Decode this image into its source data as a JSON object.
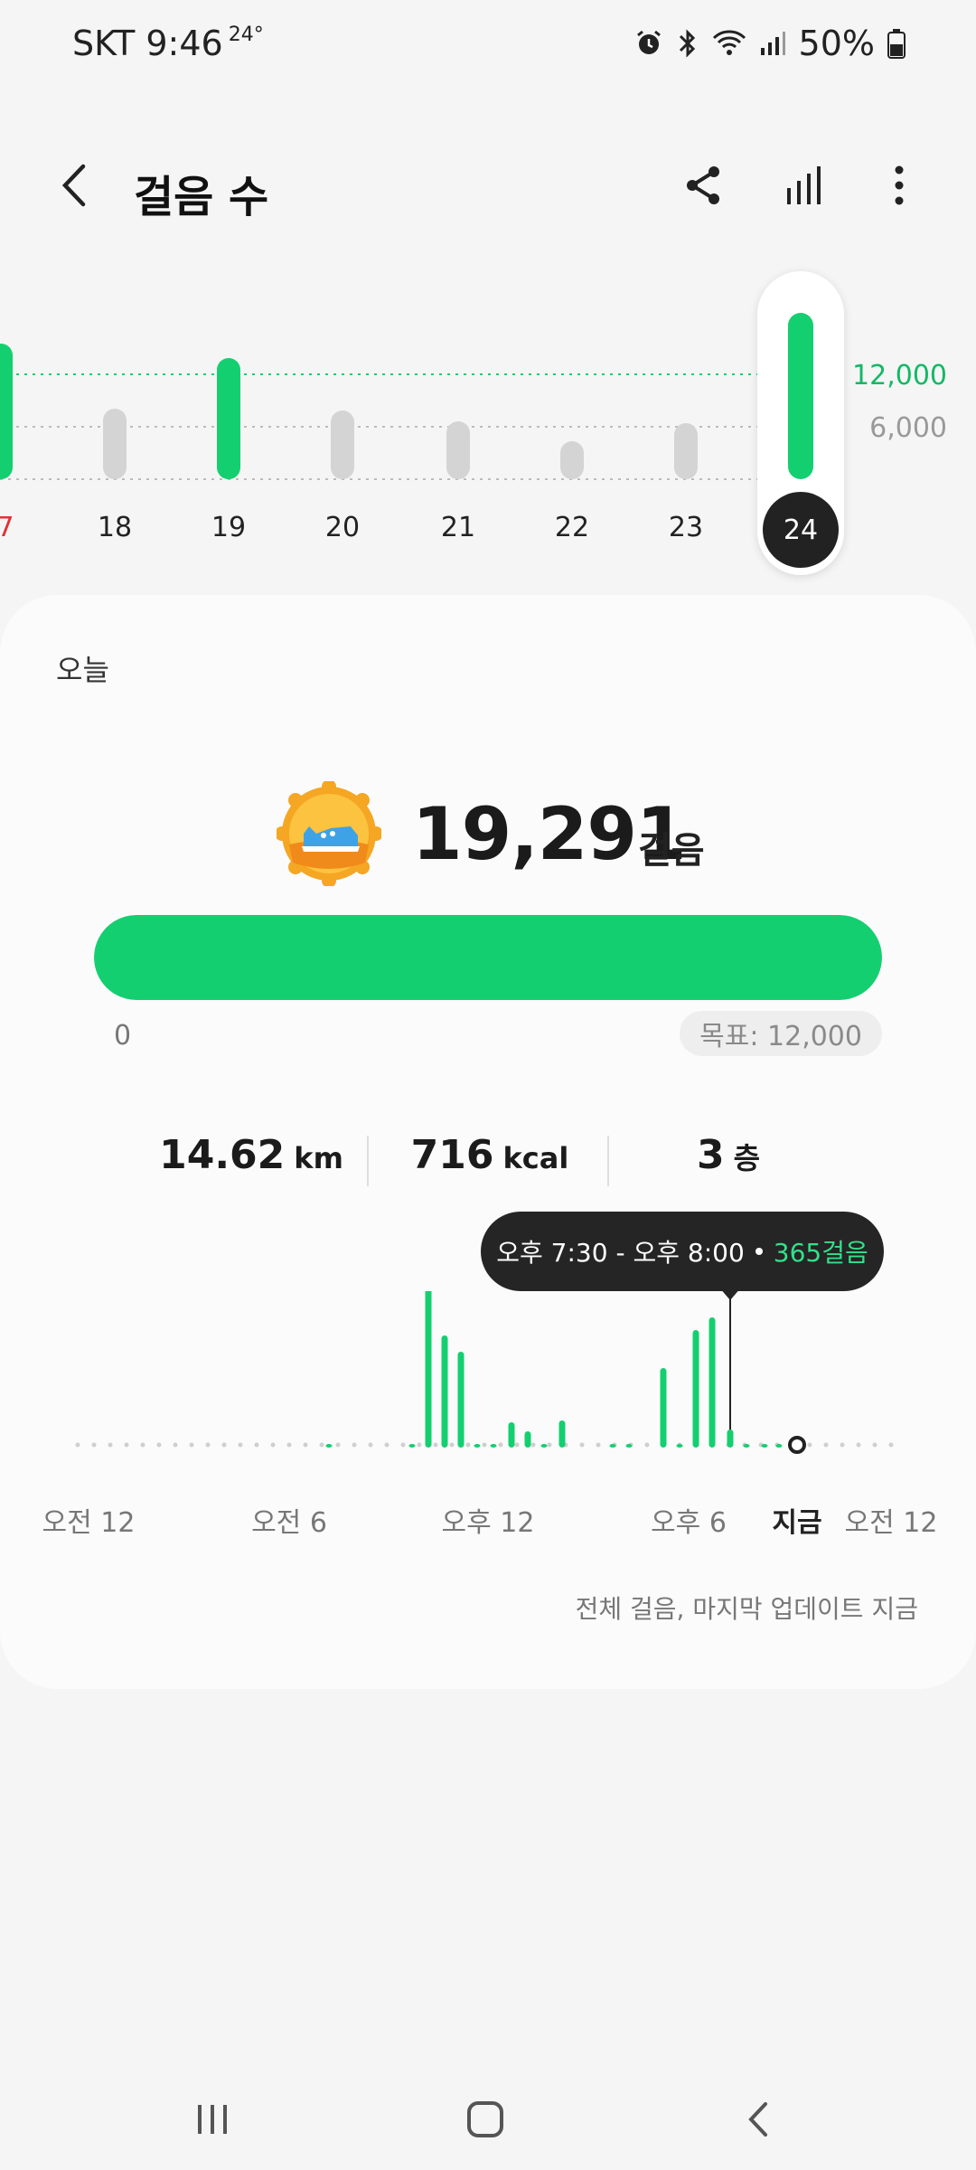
{
  "status_bar": {
    "carrier_time": "SKT 9:46",
    "temperature": "24°",
    "battery": "50%"
  },
  "header": {
    "title": "걸음 수",
    "back_icon": "chevron-left-icon",
    "actions": [
      "share-icon",
      "bar-chart-icon",
      "more-vertical-icon"
    ]
  },
  "week_chart": {
    "days": [
      "7",
      "18",
      "19",
      "20",
      "21",
      "22",
      "23",
      "24"
    ],
    "goal_marks": [
      "12,000",
      "6,000"
    ],
    "selected_day": "24"
  },
  "today": {
    "label": "오늘",
    "steps": "19,291",
    "steps_unit": "걸음",
    "progress_fraction": 1.0,
    "progress_min": "0",
    "goal": "목표: 12,000",
    "distance_value": "14.62",
    "distance_unit": "km",
    "calories_value": "716",
    "calories_unit": "kcal",
    "floors_value": "3",
    "floors_unit": "층"
  },
  "tooltip": {
    "time_range": "오후 7:30 - 오후 8:00",
    "steps": "365걸음"
  },
  "day_axis": {
    "labels": [
      "오전 12",
      "오전 6",
      "오후 12",
      "오후 6",
      "지금",
      "오전 12"
    ]
  },
  "footnote": "전체 걸음, 마지막 업데이트 지금",
  "colors": {
    "accent_green": "#14cf70",
    "inactive_gray": "#d4d4d4",
    "dark": "#222222"
  }
}
